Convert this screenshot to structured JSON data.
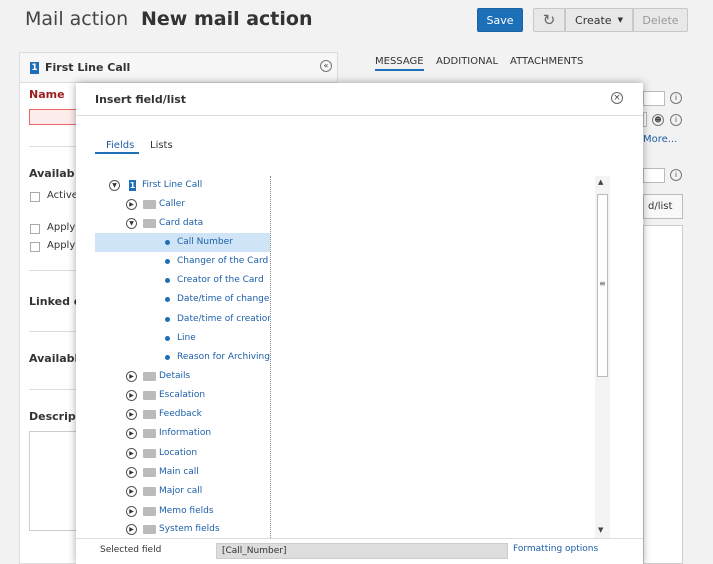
{
  "header": {
    "title_light": "Mail action",
    "title_bold": "New mail action",
    "save": "Save",
    "create": "Create",
    "delete": "Delete"
  },
  "left": {
    "card_badge": "1",
    "card_title": "First Line Call",
    "name_label": "Name",
    "available_label": "Availab",
    "active_label": "Active",
    "apply1": "Apply i",
    "apply2": "Apply i",
    "linked_label": "Linked e",
    "available2_label": "Availabl",
    "description_label": "Descript"
  },
  "right": {
    "tabs": [
      "MESSAGE",
      "ADDITIONAL",
      "ATTACHMENTS"
    ],
    "more": "More...",
    "field_list": "d/list"
  },
  "modal": {
    "title": "Insert field/list",
    "tabs": [
      "Fields",
      "Lists"
    ],
    "tree": [
      {
        "label": "First Line Call",
        "kind": "root"
      },
      {
        "label": "Caller",
        "kind": "folder-closed"
      },
      {
        "label": "Card data",
        "kind": "folder-open"
      },
      {
        "label": "Call Number",
        "kind": "field",
        "selected": true
      },
      {
        "label": "Changer of the Card",
        "kind": "field"
      },
      {
        "label": "Creator of the Card",
        "kind": "field"
      },
      {
        "label": "Date/time of change",
        "kind": "field"
      },
      {
        "label": "Date/time of creation",
        "kind": "field"
      },
      {
        "label": "Line",
        "kind": "field"
      },
      {
        "label": "Reason for Archiving",
        "kind": "field"
      },
      {
        "label": "Details",
        "kind": "folder-closed"
      },
      {
        "label": "Escalation",
        "kind": "folder-closed"
      },
      {
        "label": "Feedback",
        "kind": "folder-closed"
      },
      {
        "label": "Information",
        "kind": "folder-closed"
      },
      {
        "label": "Location",
        "kind": "folder-closed"
      },
      {
        "label": "Main call",
        "kind": "folder-closed"
      },
      {
        "label": "Major call",
        "kind": "folder-closed"
      },
      {
        "label": "Memo fields",
        "kind": "folder-closed"
      },
      {
        "label": "System fields",
        "kind": "folder-closed"
      }
    ],
    "selected_field_label": "Selected field",
    "selected_field_value": "[Call_Number]",
    "formatting_options": "Formatting options"
  },
  "colors": {
    "accent": "#1d6fb8",
    "selection": "#cfe5f7",
    "name_label": "#9b1d1d"
  }
}
